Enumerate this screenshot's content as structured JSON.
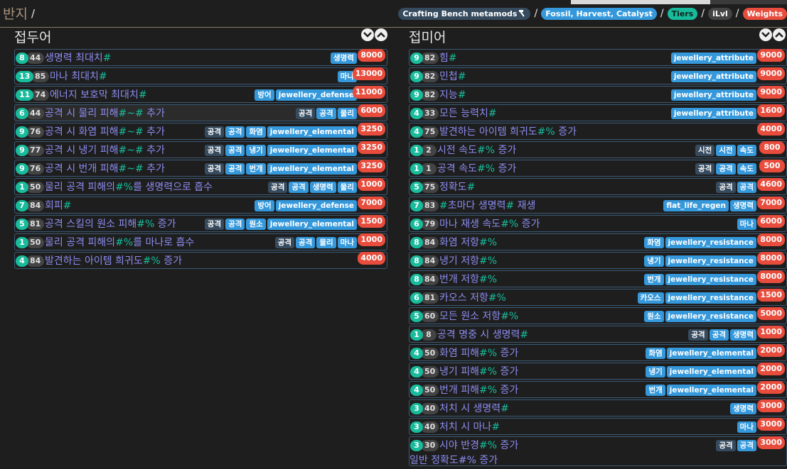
{
  "header": {
    "title": "반지",
    "title_sep": "/",
    "crumbs": [
      {
        "label": "Crafting Bench metamods",
        "style": "slate",
        "icon": "hammer-icon"
      },
      {
        "label": "Fossil, Harvest, Catalyst",
        "style": "blue"
      },
      {
        "label": "Tiers",
        "style": "green"
      },
      {
        "label": "iLvl",
        "style": "dark"
      },
      {
        "label": "Weights",
        "style": "red"
      }
    ],
    "crumb_sep": "/"
  },
  "prefix": {
    "title": "접두어",
    "rows": [
      {
        "tier": "8",
        "ilvl": "44",
        "text": "생명력 최대치",
        "hash": "#",
        "tags": [
          {
            "t": "생명력",
            "c": "blue"
          }
        ],
        "weight": "8000"
      },
      {
        "tier": "13",
        "ilvl": "85",
        "text": "마나 최대치",
        "hash": "#",
        "tags": [
          {
            "t": "마나",
            "c": "blue"
          }
        ],
        "weight": "13000"
      },
      {
        "tier": "11",
        "ilvl": "74",
        "text": "에너지 보호막 최대치",
        "hash": "#",
        "tags": [
          {
            "t": "방어",
            "c": "blue"
          },
          {
            "t": "jewellery_defense",
            "c": "blue"
          }
        ],
        "weight": "11000"
      },
      {
        "tier": "6",
        "ilvl": "44",
        "text": "공격 시 물리 피해",
        "hash": "#~#",
        "post": " 추가",
        "tags": [
          {
            "t": "공격",
            "c": "slate"
          },
          {
            "t": "공격",
            "c": "blue"
          },
          {
            "t": "물리",
            "c": "blue"
          }
        ],
        "weight": "6000",
        "hl": true
      },
      {
        "tier": "9",
        "ilvl": "76",
        "text": "공격 시 화염 피해",
        "hash": "#~#",
        "post": " 추가",
        "tags": [
          {
            "t": "공격",
            "c": "slate"
          },
          {
            "t": "공격",
            "c": "blue"
          },
          {
            "t": "화염",
            "c": "blue"
          },
          {
            "t": "jewellery_elemental",
            "c": "blue"
          }
        ],
        "weight": "3250"
      },
      {
        "tier": "9",
        "ilvl": "77",
        "text": "공격 시 냉기 피해",
        "hash": "#~#",
        "post": " 추가",
        "tags": [
          {
            "t": "공격",
            "c": "slate"
          },
          {
            "t": "공격",
            "c": "blue"
          },
          {
            "t": "냉기",
            "c": "blue"
          },
          {
            "t": "jewellery_elemental",
            "c": "blue"
          }
        ],
        "weight": "3250"
      },
      {
        "tier": "9",
        "ilvl": "76",
        "text": "공격 시 번개 피해",
        "hash": "#~#",
        "post": " 추가",
        "tags": [
          {
            "t": "공격",
            "c": "slate"
          },
          {
            "t": "공격",
            "c": "blue"
          },
          {
            "t": "번개",
            "c": "blue"
          },
          {
            "t": "jewellery_elemental",
            "c": "blue"
          }
        ],
        "weight": "3250"
      },
      {
        "tier": "1",
        "ilvl": "50",
        "text": "물리 공격 피해의",
        "hash": "#%",
        "post": "를 생명력으로 흡수",
        "tags": [
          {
            "t": "공격",
            "c": "slate"
          },
          {
            "t": "공격",
            "c": "blue"
          },
          {
            "t": "생명력",
            "c": "blue"
          },
          {
            "t": "물리",
            "c": "blue"
          }
        ],
        "weight": "1000"
      },
      {
        "tier": "7",
        "ilvl": "84",
        "text": "회피",
        "hash": "#",
        "tags": [
          {
            "t": "방어",
            "c": "blue"
          },
          {
            "t": "jewellery_defense",
            "c": "blue"
          }
        ],
        "weight": "7000"
      },
      {
        "tier": "5",
        "ilvl": "81",
        "text": "공격 스킬의 원소 피해",
        "hash": "#%",
        "post": " 증가",
        "tags": [
          {
            "t": "공격",
            "c": "slate"
          },
          {
            "t": "공격",
            "c": "blue"
          },
          {
            "t": "원소",
            "c": "blue"
          },
          {
            "t": "jewellery_elemental",
            "c": "blue"
          }
        ],
        "weight": "1500"
      },
      {
        "tier": "1",
        "ilvl": "50",
        "text": "물리 공격 피해의",
        "hash": "#%",
        "post": "를 마나로 흡수",
        "tags": [
          {
            "t": "공격",
            "c": "slate"
          },
          {
            "t": "공격",
            "c": "blue"
          },
          {
            "t": "물리",
            "c": "blue"
          },
          {
            "t": "마나",
            "c": "blue"
          }
        ],
        "weight": "1000"
      },
      {
        "tier": "4",
        "ilvl": "84",
        "text": "발견하는 아이템 희귀도",
        "hash": "#%",
        "post": " 증가",
        "tags": [],
        "weight": "4000"
      }
    ]
  },
  "suffix": {
    "title": "접미어",
    "rows": [
      {
        "tier": "9",
        "ilvl": "82",
        "text": "힘",
        "hash": "#",
        "tags": [
          {
            "t": "jewellery_attribute",
            "c": "blue"
          }
        ],
        "weight": "9000"
      },
      {
        "tier": "9",
        "ilvl": "82",
        "text": "민첩",
        "hash": "#",
        "tags": [
          {
            "t": "jewellery_attribute",
            "c": "blue"
          }
        ],
        "weight": "9000"
      },
      {
        "tier": "9",
        "ilvl": "82",
        "text": "지능",
        "hash": "#",
        "tags": [
          {
            "t": "jewellery_attribute",
            "c": "blue"
          }
        ],
        "weight": "9000"
      },
      {
        "tier": "4",
        "ilvl": "33",
        "text": "모든 능력치",
        "hash": "#",
        "tags": [
          {
            "t": "jewellery_attribute",
            "c": "blue"
          }
        ],
        "weight": "1600"
      },
      {
        "tier": "4",
        "ilvl": "75",
        "text": "발견하는 아이템 희귀도",
        "hash": "#%",
        "post": " 증가",
        "tags": [],
        "weight": "4000"
      },
      {
        "tier": "1",
        "ilvl": "2",
        "text": "시전 속도",
        "hash": "#%",
        "post": " 증가",
        "tags": [
          {
            "t": "시전",
            "c": "slate"
          },
          {
            "t": "시전",
            "c": "blue"
          },
          {
            "t": "속도",
            "c": "blue"
          }
        ],
        "weight": "800"
      },
      {
        "tier": "1",
        "ilvl": "1",
        "text": "공격 속도",
        "hash": "#%",
        "post": " 증가",
        "tags": [
          {
            "t": "공격",
            "c": "slate"
          },
          {
            "t": "공격",
            "c": "blue"
          },
          {
            "t": "속도",
            "c": "blue"
          }
        ],
        "weight": "500"
      },
      {
        "tier": "5",
        "ilvl": "75",
        "text": "정확도",
        "hash": "#",
        "tags": [
          {
            "t": "공격",
            "c": "slate"
          },
          {
            "t": "공격",
            "c": "blue"
          }
        ],
        "weight": "4600"
      },
      {
        "tier": "7",
        "ilvl": "83",
        "text": "",
        "hash": "#",
        "post": "초마다 생명력",
        "hash2": "#",
        "post2": " 재생",
        "tags": [
          {
            "t": "flat_life_regen",
            "c": "blue"
          },
          {
            "t": "생명력",
            "c": "blue"
          }
        ],
        "weight": "7000"
      },
      {
        "tier": "6",
        "ilvl": "79",
        "text": "마나 재생 속도",
        "hash": "#%",
        "post": " 증가",
        "tags": [
          {
            "t": "마나",
            "c": "blue"
          }
        ],
        "weight": "6000"
      },
      {
        "tier": "8",
        "ilvl": "84",
        "text": "화염 저항",
        "hash": "#%",
        "tags": [
          {
            "t": "화염",
            "c": "blue"
          },
          {
            "t": "jewellery_resistance",
            "c": "blue"
          }
        ],
        "weight": "8000"
      },
      {
        "tier": "8",
        "ilvl": "84",
        "text": "냉기 저항",
        "hash": "#%",
        "tags": [
          {
            "t": "냉기",
            "c": "blue"
          },
          {
            "t": "jewellery_resistance",
            "c": "blue"
          }
        ],
        "weight": "8000"
      },
      {
        "tier": "8",
        "ilvl": "84",
        "text": "번개 저항",
        "hash": "#%",
        "tags": [
          {
            "t": "번개",
            "c": "blue"
          },
          {
            "t": "jewellery_resistance",
            "c": "blue"
          }
        ],
        "weight": "8000"
      },
      {
        "tier": "6",
        "ilvl": "81",
        "text": "카오스 저항",
        "hash": "#%",
        "tags": [
          {
            "t": "카오스",
            "c": "blue"
          },
          {
            "t": "jewellery_resistance",
            "c": "blue"
          }
        ],
        "weight": "1500"
      },
      {
        "tier": "5",
        "ilvl": "60",
        "text": "모든 원소 저항",
        "hash": "#%",
        "tags": [
          {
            "t": "원소",
            "c": "blue"
          },
          {
            "t": "jewellery_resistance",
            "c": "blue"
          }
        ],
        "weight": "5000"
      },
      {
        "tier": "1",
        "ilvl": "8",
        "text": "공격 명중 시 생명력",
        "hash": "#",
        "tags": [
          {
            "t": "공격",
            "c": "slate"
          },
          {
            "t": "공격",
            "c": "blue"
          },
          {
            "t": "생명력",
            "c": "blue"
          }
        ],
        "weight": "1000"
      },
      {
        "tier": "4",
        "ilvl": "50",
        "text": "화염 피해",
        "hash": "#%",
        "post": " 증가",
        "tags": [
          {
            "t": "화염",
            "c": "blue"
          },
          {
            "t": "jewellery_elemental",
            "c": "blue"
          }
        ],
        "weight": "2000"
      },
      {
        "tier": "4",
        "ilvl": "50",
        "text": "냉기 피해",
        "hash": "#%",
        "post": " 증가",
        "tags": [
          {
            "t": "냉기",
            "c": "blue"
          },
          {
            "t": "jewellery_elemental",
            "c": "blue"
          }
        ],
        "weight": "2000"
      },
      {
        "tier": "4",
        "ilvl": "50",
        "text": "번개 피해",
        "hash": "#%",
        "post": " 증가",
        "tags": [
          {
            "t": "번개",
            "c": "blue"
          },
          {
            "t": "jewellery_elemental",
            "c": "blue"
          }
        ],
        "weight": "2000"
      },
      {
        "tier": "3",
        "ilvl": "40",
        "text": "처치 시 생명력",
        "hash": "#",
        "tags": [
          {
            "t": "생명력",
            "c": "blue"
          }
        ],
        "weight": "3000"
      },
      {
        "tier": "3",
        "ilvl": "40",
        "text": "처치 시 마나",
        "hash": "#",
        "tags": [
          {
            "t": "마나",
            "c": "blue"
          }
        ],
        "weight": "3000"
      },
      {
        "tier": "3",
        "ilvl": "30",
        "text": "시야 반경",
        "hash": "#%",
        "post": " 증가",
        "second_text": "일반 정확도",
        "second_hash": "#%",
        "second_post": " 증가",
        "tags": [
          {
            "t": "공격",
            "c": "slate"
          },
          {
            "t": "공격",
            "c": "blue"
          }
        ],
        "weight": "3000"
      }
    ]
  }
}
